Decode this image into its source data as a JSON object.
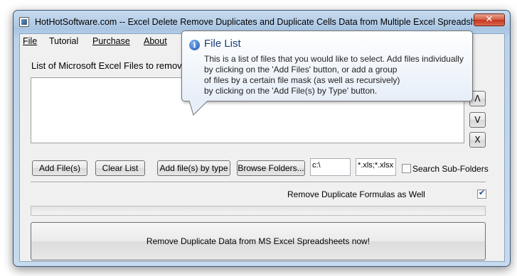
{
  "window": {
    "title": "HotHotSoftware.com -- Excel Delete Remove Duplicates and Duplicate Cells Data from Multiple Excel Spreadsh...",
    "close_glyph": "✕"
  },
  "menu": {
    "items": [
      {
        "label": "File"
      },
      {
        "label": "Tutorial"
      },
      {
        "label": "Purchase"
      },
      {
        "label": "About"
      }
    ]
  },
  "main": {
    "list_label": "List of Microsoft Excel Files to remov",
    "side_buttons": {
      "up": "Λ",
      "down": "V",
      "remove": "X"
    },
    "buttons": {
      "add_files": "Add File(s)",
      "clear_list": "Clear List",
      "add_by_type": "Add file(s) by type",
      "browse_folders": "Browse Folders..."
    },
    "folder_input": {
      "value": "c:\\"
    },
    "mask_input": {
      "value": "*.xls;*.xlsx"
    },
    "search_subfolders": {
      "label": "Search Sub-Folders",
      "checked": false
    },
    "remove_formulas": {
      "label": "Remove Duplicate Formulas as Well",
      "checked": true
    },
    "progress": {
      "value": 0
    },
    "run_button": "Remove Duplicate Data from MS Excel Spreadsheets now!"
  },
  "tooltip": {
    "title": "File List",
    "lines": [
      "This is a list of files that you would like to select. Add files individually",
      "by clicking on the 'Add Files' button, or add a group",
      "of files by a certain file mask (as well as recursively)",
      "by clicking on the 'Add File(s) by Type' button."
    ]
  }
}
